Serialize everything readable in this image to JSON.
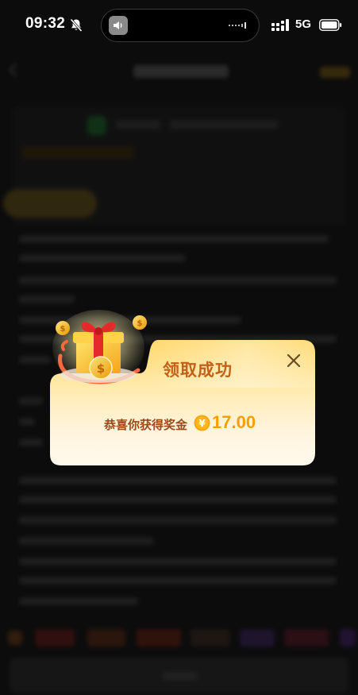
{
  "status_bar": {
    "time": "09:32",
    "network": "5G"
  },
  "reward_dialog": {
    "title": "领取成功",
    "message": "恭喜你获得奖金",
    "currency_symbol": "¥",
    "amount": "17.00"
  },
  "colors": {
    "title": "#c26019",
    "message": "#9a4a1b",
    "amount": "#f5a000",
    "dialog_gradient_top": "#ffd86b",
    "dialog_gradient_bottom": "#fff7e6"
  },
  "icons": {
    "bell": "bell-slash-icon",
    "signal": "cellular-signal-icon",
    "battery": "battery-icon",
    "close": "close-icon",
    "coin": "yen-coin-icon",
    "gift": "gift-box-icon"
  }
}
